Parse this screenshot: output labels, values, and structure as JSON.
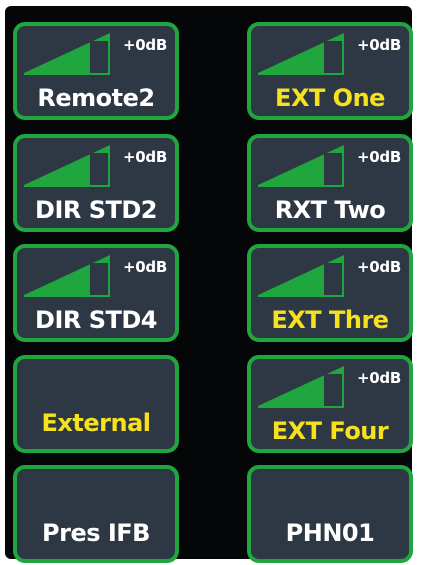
{
  "colors": {
    "border": "#1fa63f",
    "panel": "#2e3744",
    "label_white": "#ffffff",
    "label_yellow": "#f5e11d",
    "meter_fill": "#1fa63f"
  },
  "buttons": [
    {
      "label": "Remote2",
      "gain": "+0dB",
      "color": "white",
      "icon": "gain-ramp-icon"
    },
    {
      "label": "EXT One",
      "gain": "+0dB",
      "color": "yellow",
      "icon": "gain-ramp-icon"
    },
    {
      "label": "DIR STD2",
      "gain": "+0dB",
      "color": "white",
      "icon": "gain-ramp-icon"
    },
    {
      "label": "RXT Two",
      "gain": "+0dB",
      "color": "white",
      "icon": "gain-ramp-icon"
    },
    {
      "label": "DIR STD4",
      "gain": "+0dB",
      "color": "white",
      "icon": "gain-ramp-icon"
    },
    {
      "label": "EXT Thre",
      "gain": "+0dB",
      "color": "yellow",
      "icon": "gain-ramp-icon"
    },
    {
      "label": "External",
      "color": "yellow"
    },
    {
      "label": "EXT Four",
      "gain": "+0dB",
      "color": "yellow",
      "icon": "gain-ramp-icon"
    },
    {
      "label": "Pres IFB",
      "color": "white"
    },
    {
      "label": "PHN01",
      "color": "white"
    }
  ]
}
